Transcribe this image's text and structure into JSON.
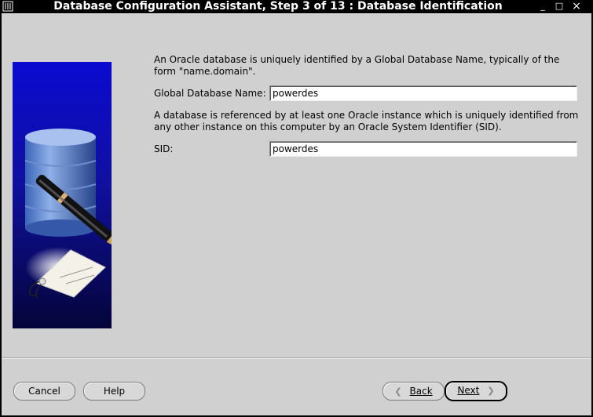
{
  "window": {
    "title": "Database Configuration Assistant, Step 3 of 13 : Database Identification",
    "controls": {
      "minimize": "_",
      "maximize": "□",
      "close": "×"
    }
  },
  "main": {
    "intro_text": "An Oracle database is uniquely identified by a Global Database Name, typically of the form \"name.domain\".",
    "global_db_name_label": "Global Database Name:",
    "global_db_name_value": "powerdes",
    "sid_intro_text": "A database is referenced by at least one Oracle instance which is uniquely identified from any other instance on this computer by an Oracle System Identifier (SID).",
    "sid_label": "SID:",
    "sid_value": "powerdes"
  },
  "footer": {
    "cancel_label": "Cancel",
    "help_label": "Help",
    "back_label": "Back",
    "next_label": "Next"
  },
  "icons": {
    "back": "chevron-left-icon",
    "next": "chevron-right-icon",
    "app": "window-menu-icon"
  }
}
